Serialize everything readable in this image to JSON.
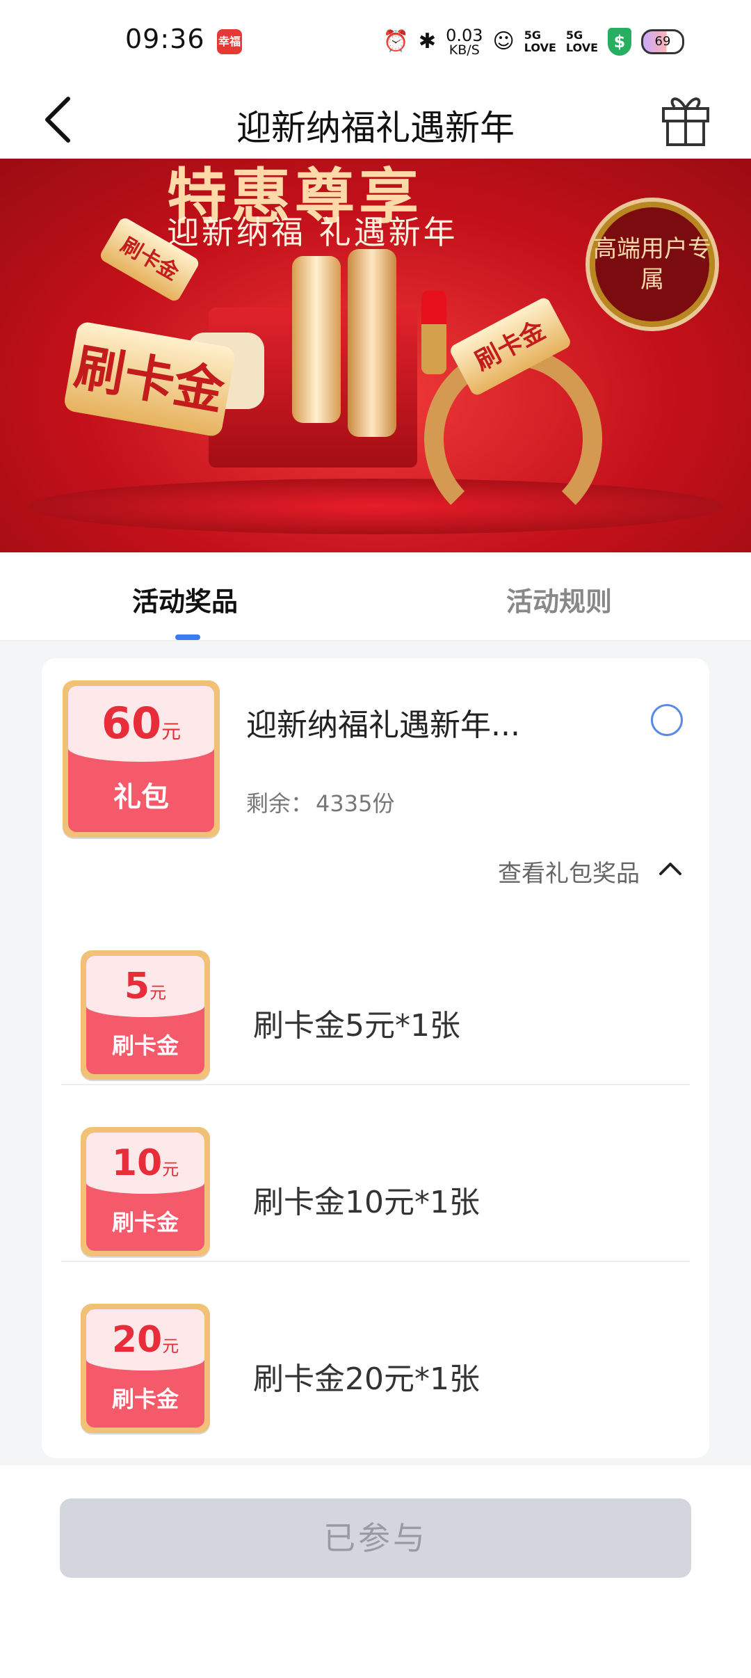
{
  "status_bar": {
    "time": "09:36",
    "app_badge": "幸福",
    "net_speed_value": "0.03",
    "net_speed_unit": "KB/S",
    "signal1": "5G",
    "signal1_sub": "LOVE",
    "signal2": "5G",
    "signal2_sub": "LOVE",
    "shield": "$",
    "battery": "69"
  },
  "nav": {
    "title": "迎新纳福礼遇新年"
  },
  "banner": {
    "headline": "特惠尊享",
    "subline": "迎新纳福  礼遇新年",
    "seal_text": "高端用户专属",
    "ribbon_main": "刷卡金",
    "ribbon_small": "刷卡金",
    "ribbon_right": "刷卡金"
  },
  "tabs": {
    "active": "活动奖品",
    "inactive": "活动规则"
  },
  "package": {
    "coupon_amount": "60",
    "coupon_unit": "元",
    "coupon_name": "礼包",
    "title": "迎新纳福礼遇新年...",
    "remain_label": "剩余：",
    "remain_value": "4335份",
    "view_prizes": "查看礼包奖品"
  },
  "prizes": [
    {
      "amount": "5",
      "unit": "元",
      "name": "刷卡金",
      "label": "刷卡金5元*1张"
    },
    {
      "amount": "10",
      "unit": "元",
      "name": "刷卡金",
      "label": "刷卡金10元*1张"
    },
    {
      "amount": "20",
      "unit": "元",
      "name": "刷卡金",
      "label": "刷卡金20元*1张"
    }
  ],
  "bottom": {
    "button_label": "已参与"
  },
  "colors": {
    "accent_blue": "#3b7bf0",
    "coupon_red": "#f55a6a",
    "disabled_button": "#d4d6de"
  }
}
